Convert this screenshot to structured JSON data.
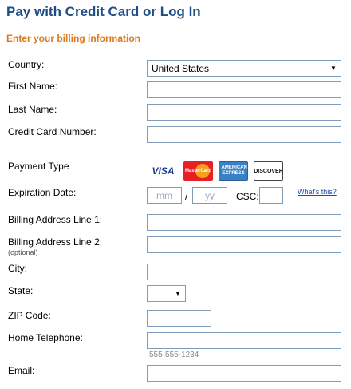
{
  "header": {
    "title": "Pay with Credit Card or Log In",
    "subtitle": "Enter your billing information"
  },
  "fields": {
    "country_label": "Country:",
    "country_value": "United States",
    "first_name_label": "First Name:",
    "first_name_value": "",
    "last_name_label": "Last Name:",
    "last_name_value": "",
    "card_number_label": "Credit Card Number:",
    "card_number_value": "",
    "payment_type_label": "Payment Type",
    "expiration_label": "Expiration Date:",
    "exp_month_placeholder": "mm",
    "exp_year_placeholder": "yy",
    "exp_separator": "/",
    "csc_label": "CSC:",
    "csc_value": "",
    "whats_this": "What's this?",
    "billing1_label": "Billing Address Line 1:",
    "billing1_value": "",
    "billing2_label": "Billing Address Line 2:",
    "billing2_optional": "(optional)",
    "billing2_value": "",
    "city_label": "City:",
    "city_value": "",
    "state_label": "State:",
    "state_value": "",
    "zip_label": "ZIP Code:",
    "zip_value": "",
    "phone_label": "Home Telephone:",
    "phone_value": "",
    "phone_hint": "555-555-1234",
    "email_label": "Email:",
    "email_value": ""
  },
  "payment_cards": [
    {
      "name": "VISA",
      "icon": "visa-logo-icon"
    },
    {
      "name": "MasterCard",
      "icon": "mastercard-logo-icon"
    },
    {
      "name": "AMERICAN EXPRESS",
      "icon": "amex-logo-icon"
    },
    {
      "name": "DISCOVER",
      "icon": "discover-logo-icon"
    }
  ],
  "colors": {
    "title": "#1f4e86",
    "subtitle": "#d97a1c",
    "input_border": "#7f9db9",
    "link": "#1f4ea5"
  }
}
